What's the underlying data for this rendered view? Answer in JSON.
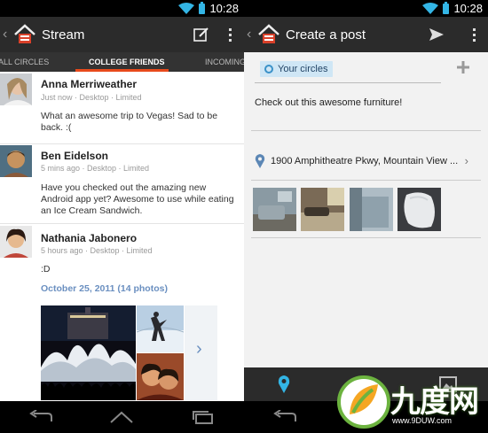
{
  "left": {
    "status_time": "10:28",
    "title": "Stream",
    "tabs": [
      "ALL CIRCLES",
      "COLLEGE FRIENDS",
      "INCOMING"
    ],
    "posts": [
      {
        "name": "Anna Merriweather",
        "meta": "Just now · Desktop · Limited",
        "text": "What an awesome trip to Vegas! Sad to be back. :("
      },
      {
        "name": "Ben Eidelson",
        "meta": "5 mins ago · Desktop · Limited",
        "text": "Have you checked out the amazing new Android app yet? Awesome to use while eating an Ice Cream Sandwich."
      },
      {
        "name": "Nathania Jabonero",
        "meta": "5 hours ago · Desktop · Limited",
        "text": ":D",
        "album": "October 25, 2011 (14 photos)"
      }
    ]
  },
  "right": {
    "status_time": "10:28",
    "title": "Create a post",
    "circle_label": "Your circles",
    "post_text": "Check out this awesome furniture!",
    "location": "1900 Amphitheatre Pkwy, Mountain View ..."
  },
  "icons": {
    "app": "plus-home-icon",
    "compose": "compose-icon",
    "overflow": "overflow-menu-icon",
    "send": "send-icon",
    "location": "location-pin-icon",
    "camera": "camera-icon",
    "gallery": "gallery-icon",
    "back_nav": "nav-back-icon",
    "home_nav": "nav-home-icon",
    "recents_nav": "nav-recents-icon"
  },
  "colors": {
    "accent": "#e84a1c",
    "link": "#6a8fc0",
    "status_blue": "#33b5e5",
    "chip": "#cfe6f5"
  },
  "watermark": {
    "brand": "九度网",
    "url": "www.9DUW.com"
  }
}
